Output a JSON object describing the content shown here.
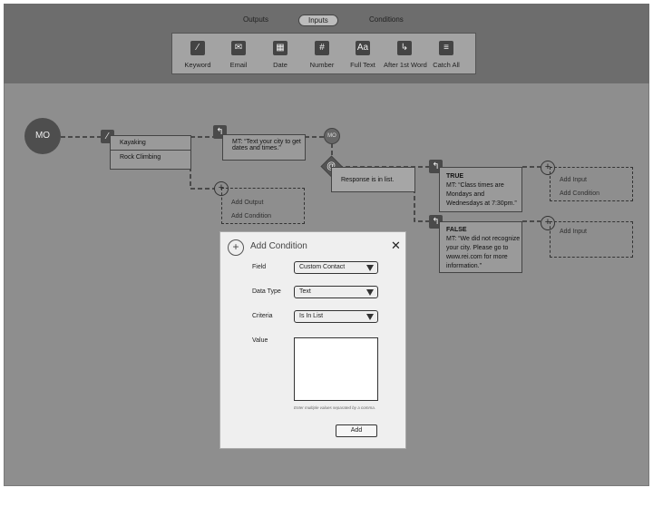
{
  "tabs": {
    "outputs": "Outputs",
    "inputs": "Inputs",
    "conditions": "Conditions"
  },
  "palette": [
    {
      "label": "Keyword",
      "icon": "wand-icon",
      "glyph": "⁄"
    },
    {
      "label": "Email",
      "icon": "envelope-icon",
      "glyph": "✉"
    },
    {
      "label": "Date",
      "icon": "calendar-icon",
      "glyph": "▦"
    },
    {
      "label": "Number",
      "icon": "hash-icon",
      "glyph": "#"
    },
    {
      "label": "Full Text",
      "icon": "text-icon",
      "glyph": "Aa"
    },
    {
      "label": "After 1st Word",
      "icon": "return-arrow-icon",
      "glyph": "↳"
    },
    {
      "label": "Catch All",
      "icon": "menu-lines-icon",
      "glyph": "≡"
    }
  ],
  "flow": {
    "start_label": "MO",
    "keywords": [
      "Kayaking",
      "Rock Climbing"
    ],
    "mt_reply": "MT: “Text your city to get dates and times.”",
    "mo_small": "MO",
    "add_output": "Add Output",
    "add_condition": "Add Condition",
    "condition_text": "Response is in list.",
    "true_label": "TRUE",
    "true_text": "MT: “Class times are Mondays and Wednesdays at 7:30pm.”",
    "false_label": "FALSE",
    "false_text": "MT: “We did not recognize your city. Please go to www.rei.com for more information.”",
    "true_add_input": "Add Input",
    "true_add_condition": "Add Condition",
    "false_add_input": "Add Input"
  },
  "modal": {
    "title": "Add Condition",
    "field_label": "Field",
    "field_value": "Custom Contact",
    "datatype_label": "Data Type",
    "datatype_value": "Text",
    "criteria_label": "Criteria",
    "criteria_value": "Is In List",
    "value_label": "Value",
    "hint": "Enter multiple values separated by a comma.",
    "add_button": "Add"
  }
}
